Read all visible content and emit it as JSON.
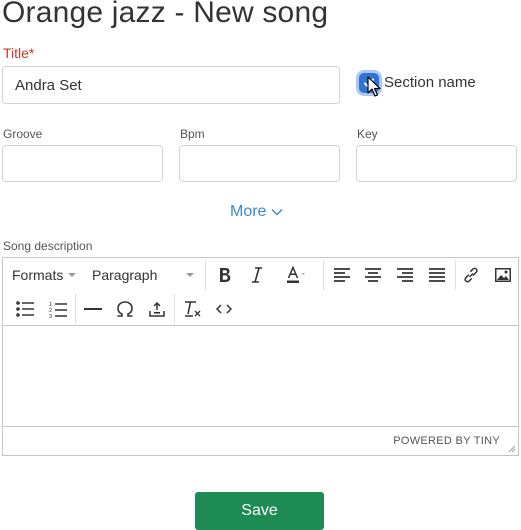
{
  "page": {
    "title": "Orange jazz - New song"
  },
  "form": {
    "title_label": "Title*",
    "title_value": "Andra Set",
    "section_checkbox_checked": true,
    "section_label": "Section name",
    "groove_label": "Groove",
    "bpm_label": "Bpm",
    "key_label": "Key",
    "more_label": "More",
    "description_label": "Song description"
  },
  "editor": {
    "formats_label": "Formats",
    "block_format_value": "Paragraph",
    "powered_by": "POWERED BY TINY"
  },
  "actions": {
    "save_label": "Save"
  },
  "colors": {
    "accent": "#2f74d0",
    "link": "#3b87d6",
    "save": "#1e8a54",
    "required": "#c0392b"
  }
}
